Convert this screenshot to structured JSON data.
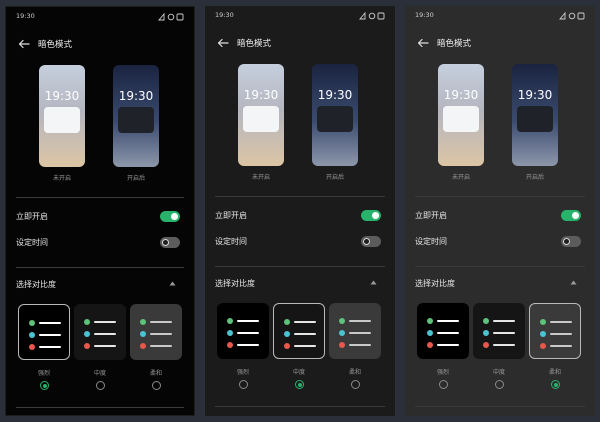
{
  "status_time": "19:30",
  "title": "暗色模式",
  "preview": {
    "time": "19:30",
    "off_label": "未开启",
    "on_label": "开启后"
  },
  "settings": [
    {
      "label": "立即开启",
      "state": "on"
    },
    {
      "label": "设定时间",
      "state": "off"
    }
  ],
  "contrast": {
    "title": "选择对比度",
    "options": [
      "强烈",
      "中度",
      "柔和"
    ]
  },
  "panels": [
    {
      "selected_contrast": 0,
      "selected_label": "强烈"
    },
    {
      "selected_contrast": 1,
      "selected_label": "中度"
    },
    {
      "selected_contrast": 2,
      "selected_label": "柔和"
    }
  ],
  "colors": {
    "accent_green": "#27b36c",
    "swatch_green": "#5fc27a",
    "swatch_cyan": "#4cc3d3",
    "swatch_red": "#e8584a"
  }
}
